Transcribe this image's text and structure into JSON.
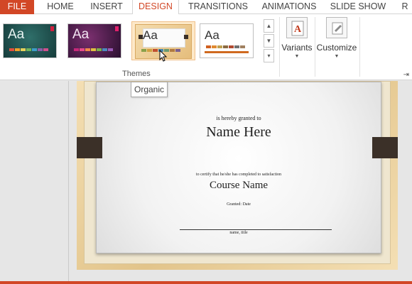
{
  "tabs": [
    {
      "label": "FILE"
    },
    {
      "label": "HOME"
    },
    {
      "label": "INSERT"
    },
    {
      "label": "DESIGN"
    },
    {
      "label": "TRANSITIONS"
    },
    {
      "label": "ANIMATIONS"
    },
    {
      "label": "SLIDE SHOW"
    },
    {
      "label": "R"
    }
  ],
  "themes": {
    "group_label": "Themes",
    "items": [
      {
        "aa": "Aa",
        "name": "theme-teal"
      },
      {
        "aa": "Aa",
        "name": "theme-purple"
      },
      {
        "aa": "Aa",
        "name": "theme-organic"
      },
      {
        "aa": "Aa",
        "name": "theme-plain"
      }
    ],
    "tooltip": "Organic"
  },
  "buttons": {
    "variants": "Variants",
    "customize": "Customize"
  },
  "certificate": {
    "granted_to": "is hereby granted to",
    "name": "Name Here",
    "certify_text": "to certify that he/she has completed to satisfaction",
    "course": "Course Name",
    "granted_date": "Granted: Date",
    "signature_caption": "name, title"
  },
  "colors": {
    "accent": "#d24726"
  }
}
